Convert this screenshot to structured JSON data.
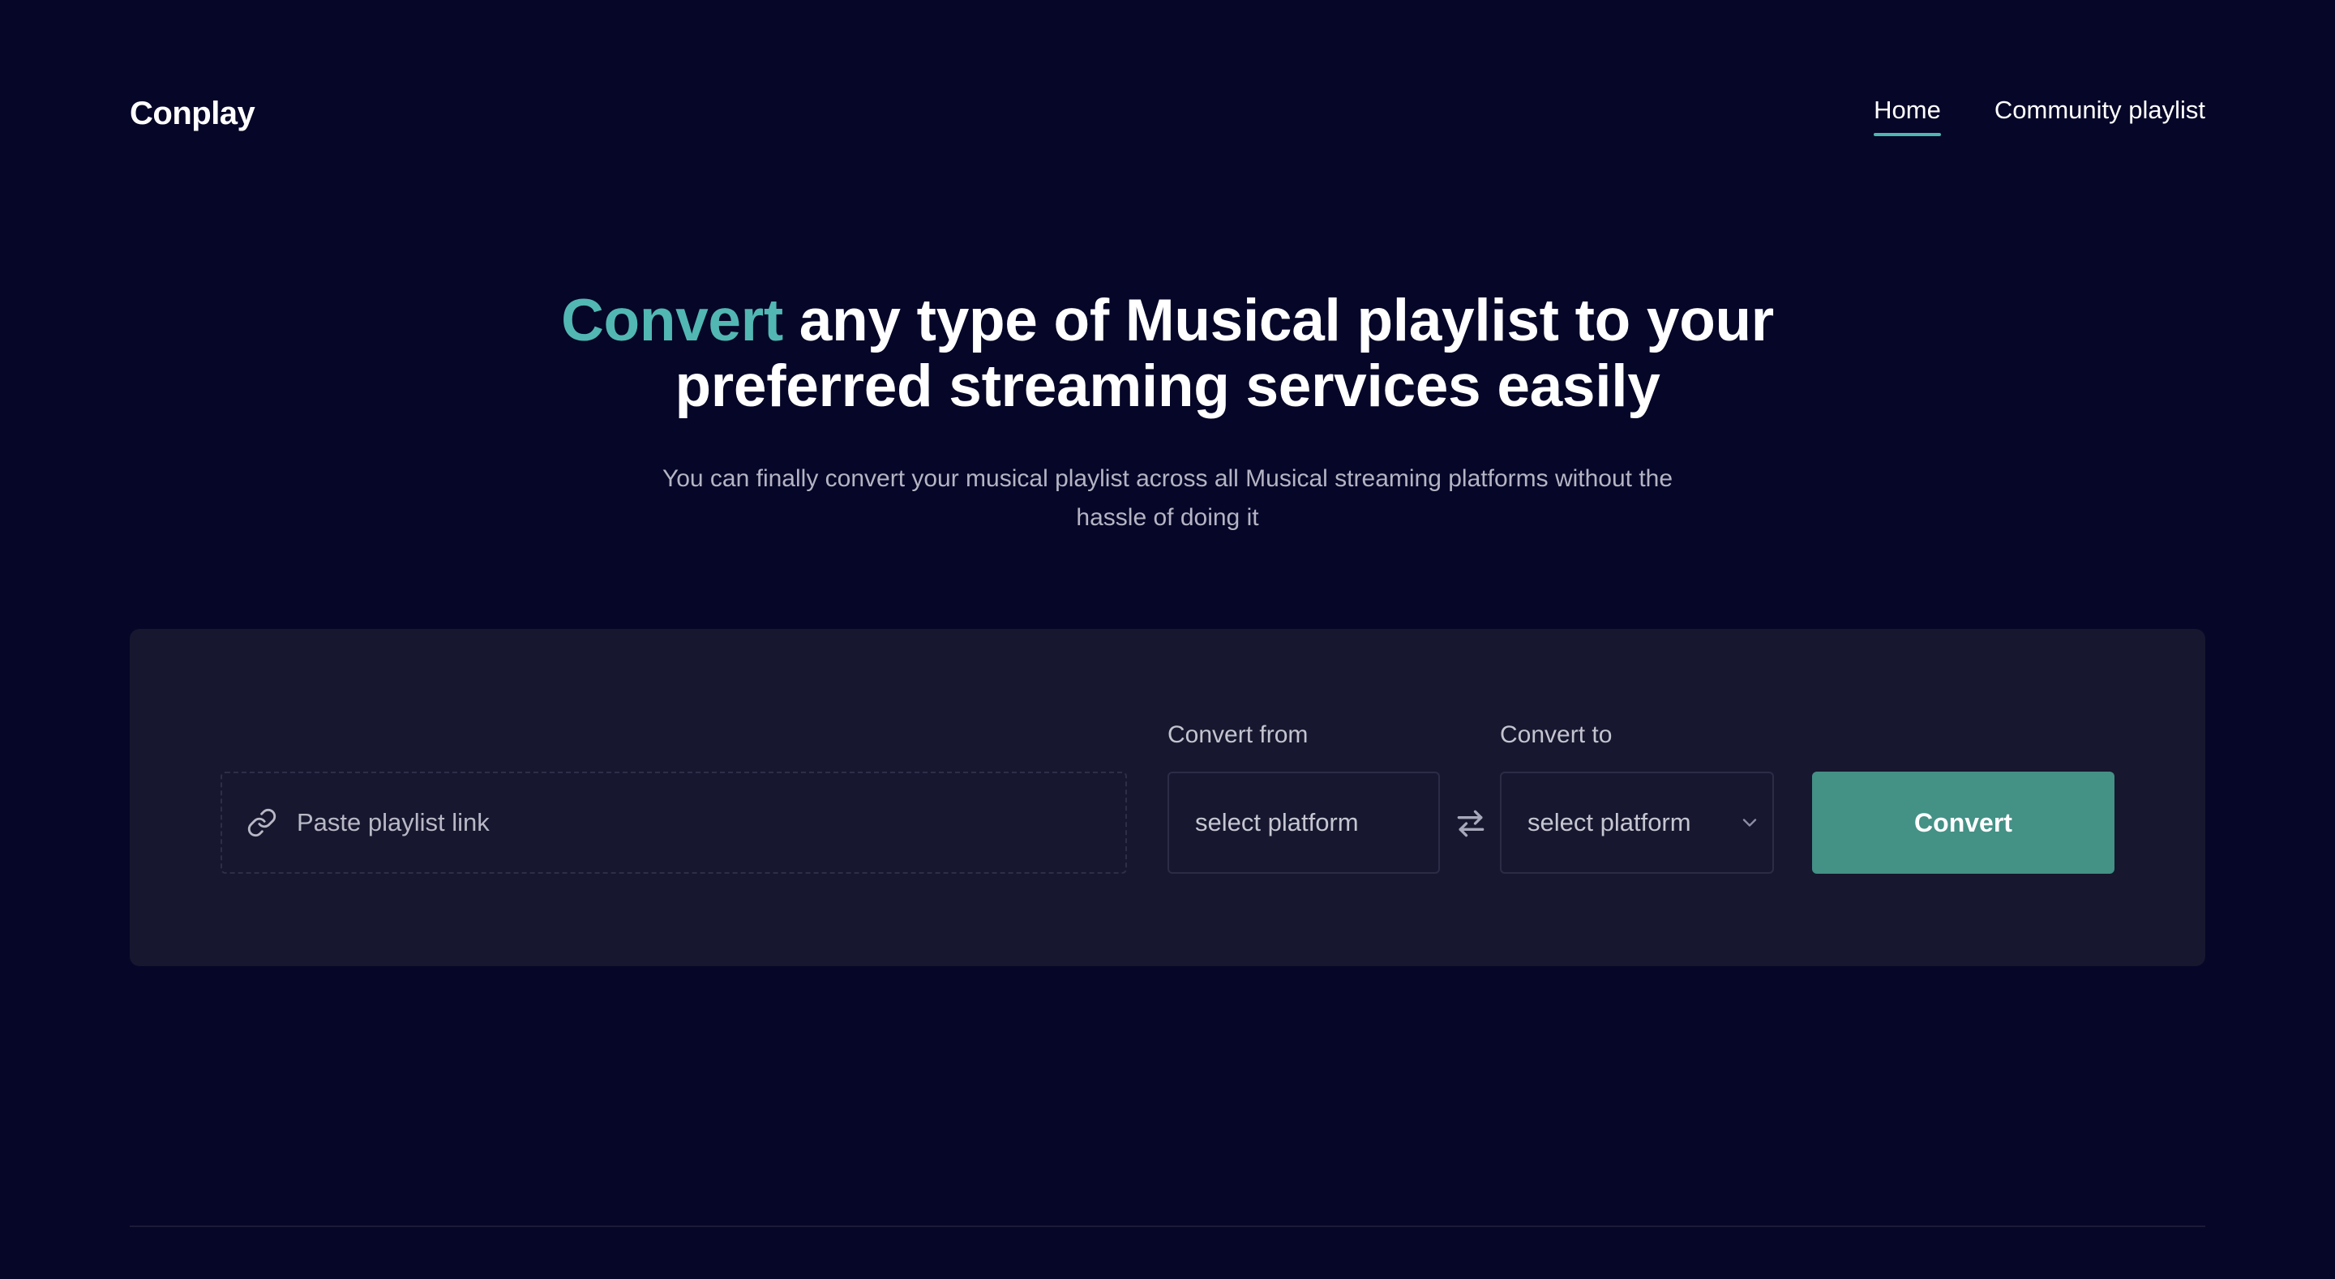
{
  "brand": {
    "name": "Conplay"
  },
  "nav": {
    "items": [
      {
        "label": "Home",
        "active": true
      },
      {
        "label": "Community playlist",
        "active": false
      }
    ]
  },
  "hero": {
    "title_accent": "Convert",
    "title_rest": " any type of Musical playlist to your preferred streaming services easily",
    "subtitle": "You can finally convert your musical playlist across all Musical streaming platforms without the hassle of doing it"
  },
  "converter": {
    "link_placeholder": "Paste playlist link",
    "link_icon": "link-icon",
    "from_label": "Convert from",
    "from_value": "select platform",
    "swap_icon": "swap-arrows-icon",
    "to_label": "Convert to",
    "to_value": "select platform",
    "to_icon": "chevron-down-icon",
    "button_label": "Convert"
  },
  "colors": {
    "background": "#060628",
    "card": "#17172f",
    "accent": "#52b7b3",
    "button": "#449186",
    "nav_underline": "#4fb6b0"
  }
}
